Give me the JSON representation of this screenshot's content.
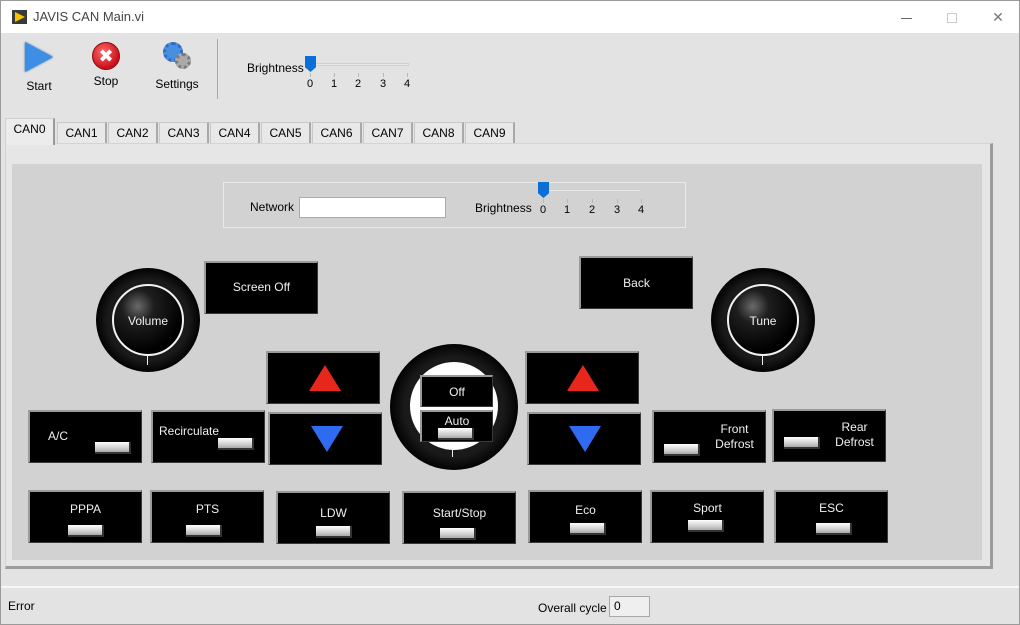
{
  "window": {
    "title": "JAVIS CAN Main.vi",
    "controls": {
      "minimize": "minimize",
      "maximize": "maximize",
      "close": "✕"
    }
  },
  "toolbar": {
    "start_label": "Start",
    "stop_label": "Stop",
    "settings_label": "Settings",
    "stop_glyph": "✖",
    "brightness": {
      "label": "Brightness",
      "value": 0,
      "ticks": [
        "0",
        "1",
        "2",
        "3",
        "4"
      ]
    }
  },
  "tabs": [
    {
      "label": "CAN0",
      "active": true
    },
    {
      "label": "CAN1"
    },
    {
      "label": "CAN2"
    },
    {
      "label": "CAN3"
    },
    {
      "label": "CAN4"
    },
    {
      "label": "CAN5"
    },
    {
      "label": "CAN6"
    },
    {
      "label": "CAN7"
    },
    {
      "label": "CAN8"
    },
    {
      "label": "CAN9"
    }
  ],
  "panel": {
    "network": {
      "label": "Network",
      "value": ""
    },
    "brightness": {
      "label": "Brightness",
      "value": 0,
      "ticks": [
        "0",
        "1",
        "2",
        "3",
        "4"
      ]
    },
    "knobs": {
      "volume": "Volume",
      "tune": "Tune"
    },
    "buttons": {
      "screen_off": "Screen Off",
      "back": "Back",
      "off": "Off",
      "auto": "Auto",
      "ac": "A/C",
      "recirculate": "Recirculate",
      "front_defrost_1": "Front",
      "front_defrost_2": "Defrost",
      "rear_defrost_1": "Rear",
      "rear_defrost_2": "Defrost",
      "pppa": "PPPA",
      "pts": "PTS",
      "ldw": "LDW",
      "start_stop": "Start/Stop",
      "eco": "Eco",
      "sport": "Sport",
      "esc": "ESC"
    },
    "colors": {
      "up_arrow": "#e8271c",
      "down_arrow": "#2f6bf0",
      "slider_thumb": "#0a6fd6"
    }
  },
  "status": {
    "error_label": "Error",
    "overall_cycle_label": "Overall cycle",
    "overall_cycle_value": "0"
  }
}
